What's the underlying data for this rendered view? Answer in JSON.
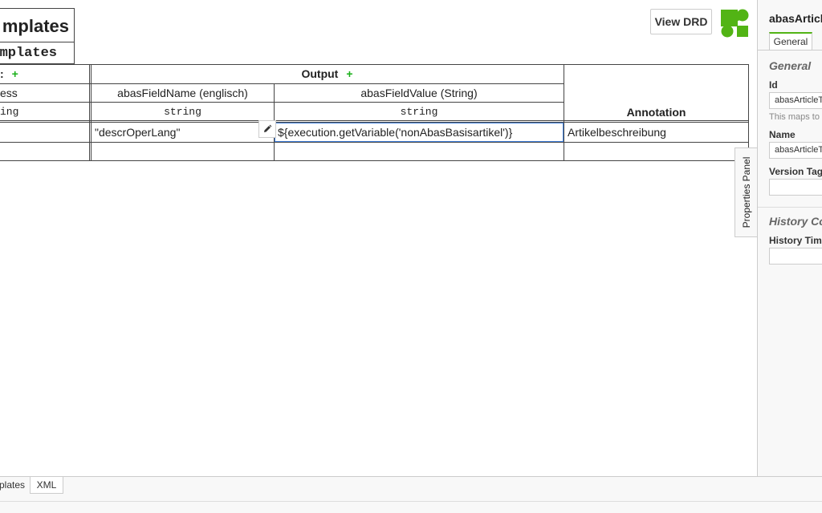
{
  "table": {
    "name": "mplates",
    "id": "mplates",
    "input_header": ":",
    "output_header": "Output",
    "plus": "+",
    "columns": {
      "input": {
        "label": "ess",
        "type": "ing"
      },
      "output1": {
        "label": "abasFieldName (englisch)",
        "type": "string"
      },
      "output2": {
        "label": "abasFieldValue (String)",
        "type": "string"
      },
      "annotation": {
        "label": "Annotation"
      }
    },
    "rows": [
      {
        "input": "",
        "output1": "\"descrOperLang\"",
        "output2": "${execution.getVariable('nonAbasBasisartikel')}",
        "annotation": "Artikelbeschreibung"
      }
    ]
  },
  "toolbar": {
    "view_drd": "View DRD"
  },
  "properties_toggle": "Properties Panel",
  "properties": {
    "title": "abasArticl",
    "tab_general": "General",
    "group_general": "General",
    "id_label": "Id",
    "id_value": "abasArticleTe",
    "id_desc": "This maps to",
    "name_label": "Name",
    "name_value": "abasArticleT",
    "version_tag_label": "Version Tag",
    "version_tag_value": "",
    "group_history": "History Co",
    "history_time_label": "History Time",
    "history_time_value": ""
  },
  "bottom_tabs": {
    "tab1": "plates",
    "tab2": "XML"
  },
  "colors": {
    "accent": "#52b415",
    "plus": "#1ab01a",
    "selection": "#3f7fdc"
  }
}
